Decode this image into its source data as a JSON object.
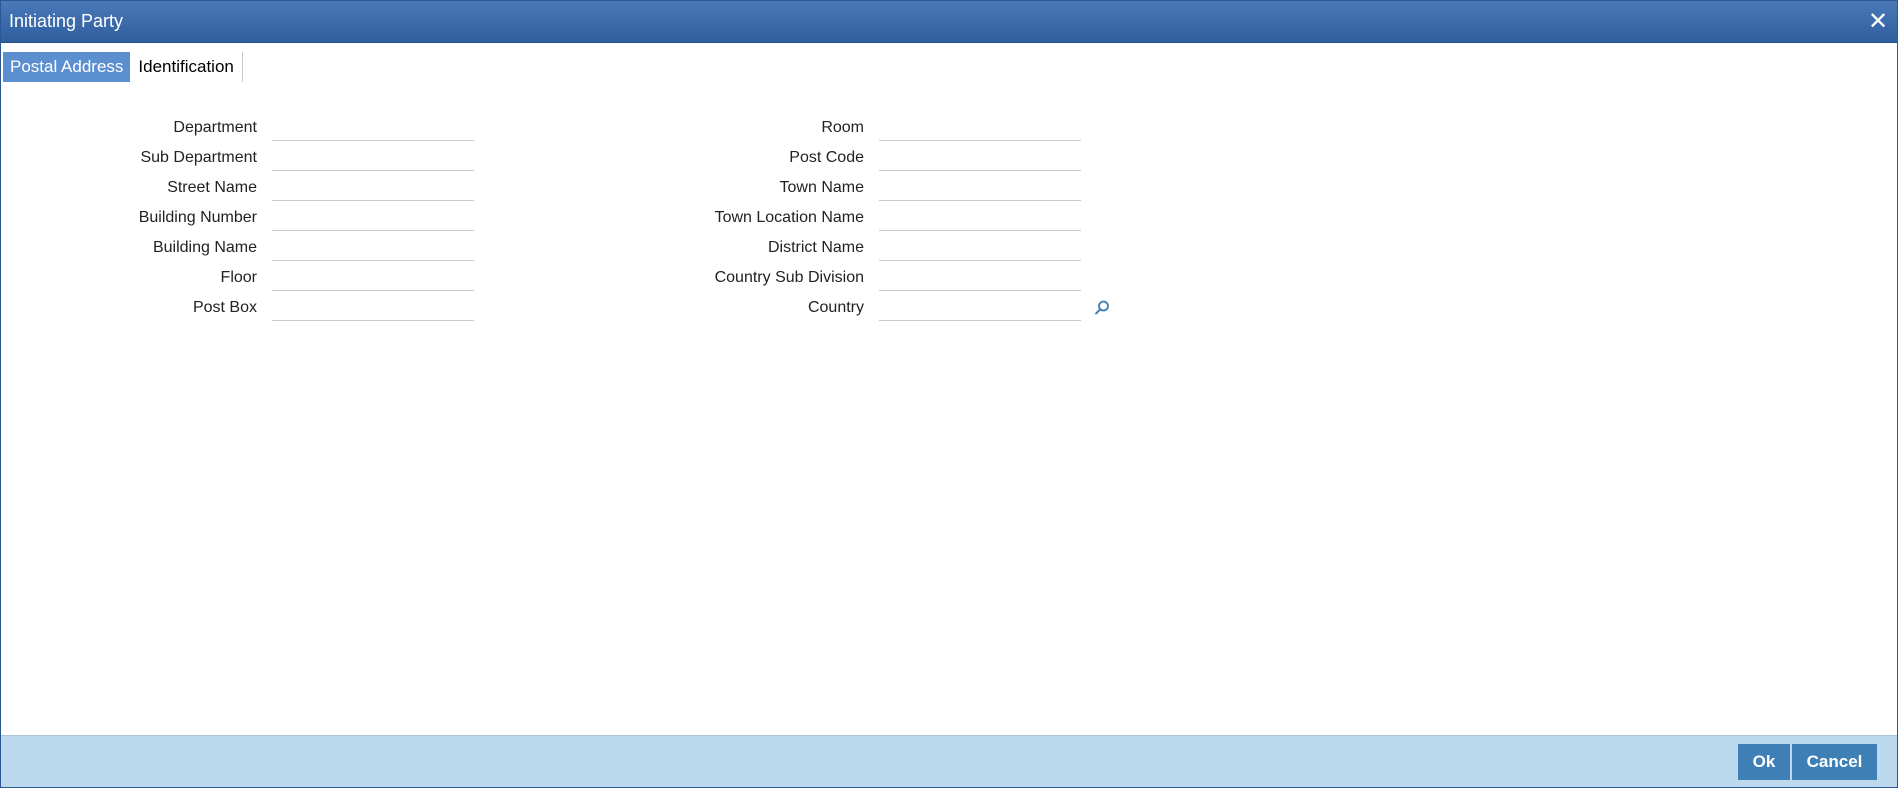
{
  "window": {
    "title": "Initiating Party",
    "close_glyph": "✕"
  },
  "tabs": [
    {
      "label": "Postal Address",
      "active": true
    },
    {
      "label": "Identification",
      "active": false
    }
  ],
  "left_fields": [
    {
      "label": "Department",
      "value": ""
    },
    {
      "label": "Sub Department",
      "value": ""
    },
    {
      "label": "Street Name",
      "value": ""
    },
    {
      "label": "Building Number",
      "value": ""
    },
    {
      "label": "Building Name",
      "value": ""
    },
    {
      "label": "Floor",
      "value": ""
    },
    {
      "label": "Post Box",
      "value": ""
    }
  ],
  "right_fields": [
    {
      "label": "Room",
      "value": ""
    },
    {
      "label": "Post Code",
      "value": ""
    },
    {
      "label": "Town Name",
      "value": ""
    },
    {
      "label": "Town Location Name",
      "value": ""
    },
    {
      "label": "District Name",
      "value": ""
    },
    {
      "label": "Country Sub Division",
      "value": ""
    },
    {
      "label": "Country",
      "value": "",
      "lookup_icon": "search-icon"
    }
  ],
  "footer": {
    "ok_label": "Ok",
    "cancel_label": "Cancel"
  },
  "colors": {
    "titlebar": "#3a6aac",
    "active_tab": "#5b8fd0",
    "footer": "#bcd9ee",
    "button": "#3e7fb6"
  }
}
